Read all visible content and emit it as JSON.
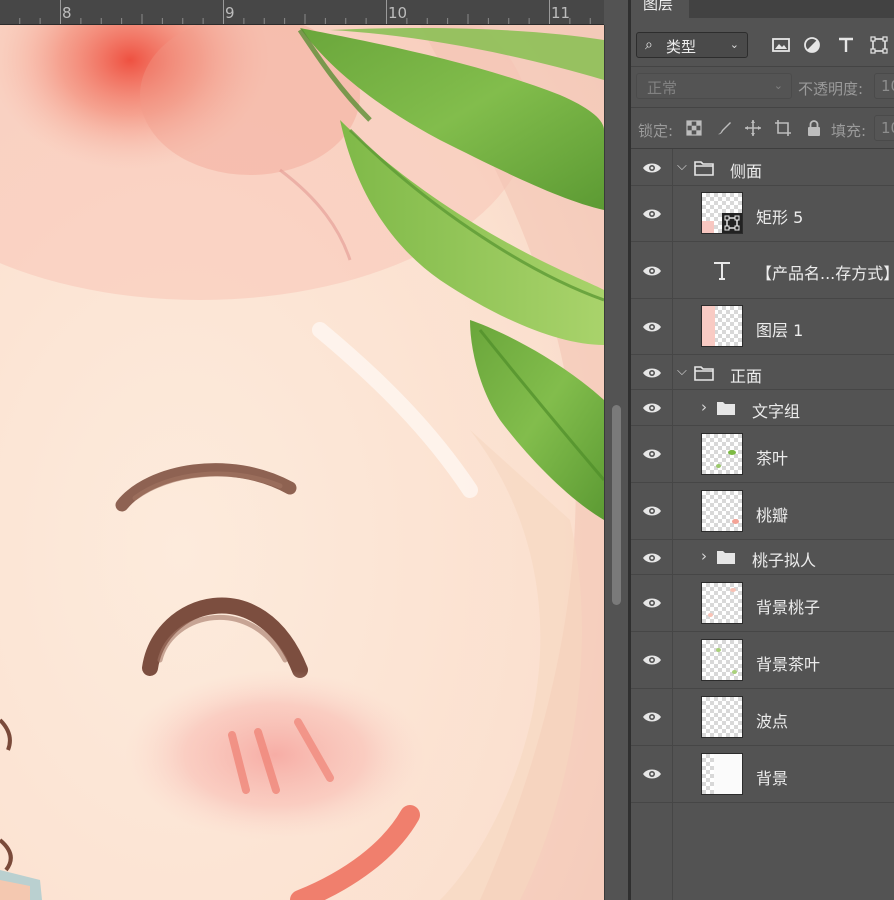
{
  "ruler": {
    "labels": [
      "8",
      "9",
      "10",
      "11"
    ]
  },
  "panel": {
    "tab_label": "图层",
    "filter": {
      "kind_label": "类型"
    },
    "blend_mode": "正常",
    "opacity_label": "不透明度:",
    "opacity_value": "10",
    "lock_label": "锁定:",
    "fill_label": "填充:",
    "fill_value": "10"
  },
  "layers": [
    {
      "name": "侧面",
      "kind": "group",
      "expanded": true,
      "indent": 0
    },
    {
      "name": "矩形 5",
      "kind": "shape",
      "indent": 1
    },
    {
      "name": "【产品名...存方式】",
      "kind": "text",
      "indent": 1
    },
    {
      "name": "图层 1",
      "kind": "pixel",
      "indent": 1
    },
    {
      "name": "正面",
      "kind": "group",
      "expanded": true,
      "indent": 0
    },
    {
      "name": "文字组",
      "kind": "group",
      "expanded": false,
      "indent": 1
    },
    {
      "name": "茶叶",
      "kind": "pixel",
      "indent": 1
    },
    {
      "name": "桃瓣",
      "kind": "pixel",
      "indent": 1
    },
    {
      "name": "桃子拟人",
      "kind": "group",
      "expanded": false,
      "indent": 1
    },
    {
      "name": "背景桃子",
      "kind": "pixel",
      "indent": 1
    },
    {
      "name": "背景茶叶",
      "kind": "pixel",
      "indent": 1
    },
    {
      "name": "波点",
      "kind": "pixel",
      "indent": 1
    },
    {
      "name": "背景",
      "kind": "pixel",
      "indent": 0
    }
  ]
}
